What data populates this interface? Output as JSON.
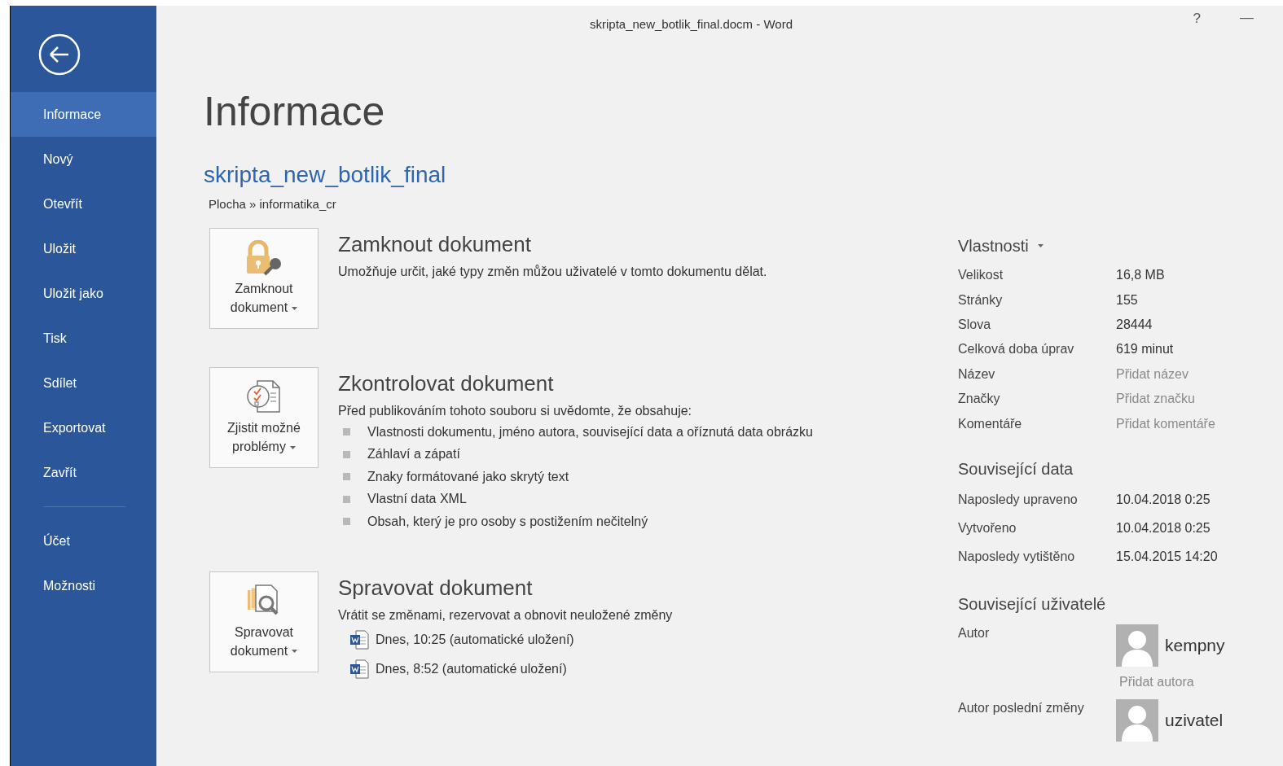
{
  "window": {
    "title": "skripta_new_botlik_final.docm - Word",
    "controls": [
      {
        "kind": "help",
        "label": "?"
      },
      {
        "kind": "minimize",
        "label": "—"
      }
    ]
  },
  "sidebar": {
    "items": [
      {
        "label": "Informace",
        "selected": true,
        "divider_before": false
      },
      {
        "label": "Nový",
        "selected": false,
        "divider_before": false
      },
      {
        "label": "Otevřít",
        "selected": false,
        "divider_before": false
      },
      {
        "label": "Uložit",
        "selected": false,
        "divider_before": false
      },
      {
        "label": "Uložit jako",
        "selected": false,
        "divider_before": false
      },
      {
        "label": "Tisk",
        "selected": false,
        "divider_before": false
      },
      {
        "label": "Sdílet",
        "selected": false,
        "divider_before": false
      },
      {
        "label": "Exportovat",
        "selected": false,
        "divider_before": false
      },
      {
        "label": "Zavřít",
        "selected": false,
        "divider_before": false
      },
      {
        "label": "Účet",
        "selected": false,
        "divider_before": true
      },
      {
        "label": "Možnosti",
        "selected": false,
        "divider_before": false
      }
    ]
  },
  "page": {
    "heading": "Informace",
    "document_name": "skripta_new_botlik_final",
    "path": "Plocha » informatika_cr"
  },
  "sections": [
    {
      "kind": "protect",
      "button_label": "Zamknout dokument",
      "title": "Zamknout dokument",
      "description": "Umožňuje určit, jaké typy změn můžou uživatelé v tomto dokumentu dělat."
    },
    {
      "kind": "inspect",
      "button_label": "Zjistit možné problémy",
      "title": "Zkontrolovat dokument",
      "description": "Před publikováním tohoto souboru si uvědomte, že obsahuje:",
      "bullets": [
        "Vlastnosti dokumentu, jméno autora, související data a oříznutá data obrázku",
        "Záhlaví a zápatí",
        "Znaky formátované jako skrytý text",
        "Vlastní data XML",
        "Obsah, který je pro osoby s postižením nečitelný"
      ]
    },
    {
      "kind": "manage",
      "button_label": "Spravovat dokument",
      "title": "Spravovat dokument",
      "description": "Vrátit se změnami, rezervovat a obnovit neuložené změny",
      "versions": [
        "Dnes, 10:25 (automatické uložení)",
        "Dnes, 8:52 (automatické uložení)"
      ]
    }
  ],
  "properties": {
    "heading": "Vlastnosti",
    "rows": [
      {
        "label": "Velikost",
        "value": "16,8 MB"
      },
      {
        "label": "Stránky",
        "value": "155"
      },
      {
        "label": "Slova",
        "value": "28444"
      },
      {
        "label": "Celková doba úprav",
        "value": "619 minut"
      },
      {
        "label": "Název",
        "placeholder": "Přidat název"
      },
      {
        "label": "Značky",
        "placeholder": "Přidat značku"
      },
      {
        "label": "Komentáře",
        "placeholder": "Přidat komentáře"
      }
    ]
  },
  "related_dates": {
    "heading": "Související data",
    "rows": [
      {
        "label": "Naposledy upraveno",
        "value": "10.04.2018 0:25"
      },
      {
        "label": "Vytvořeno",
        "value": "10.04.2018 0:25"
      },
      {
        "label": "Naposledy vytištěno",
        "value": "15.04.2015 14:20"
      }
    ]
  },
  "related_people": {
    "heading": "Související uživatelé",
    "rows": [
      {
        "label": "Autor",
        "person": "kempny",
        "add_link": "Přidat autora"
      },
      {
        "label": "Autor poslední změny",
        "person": "uzivatel"
      }
    ]
  }
}
